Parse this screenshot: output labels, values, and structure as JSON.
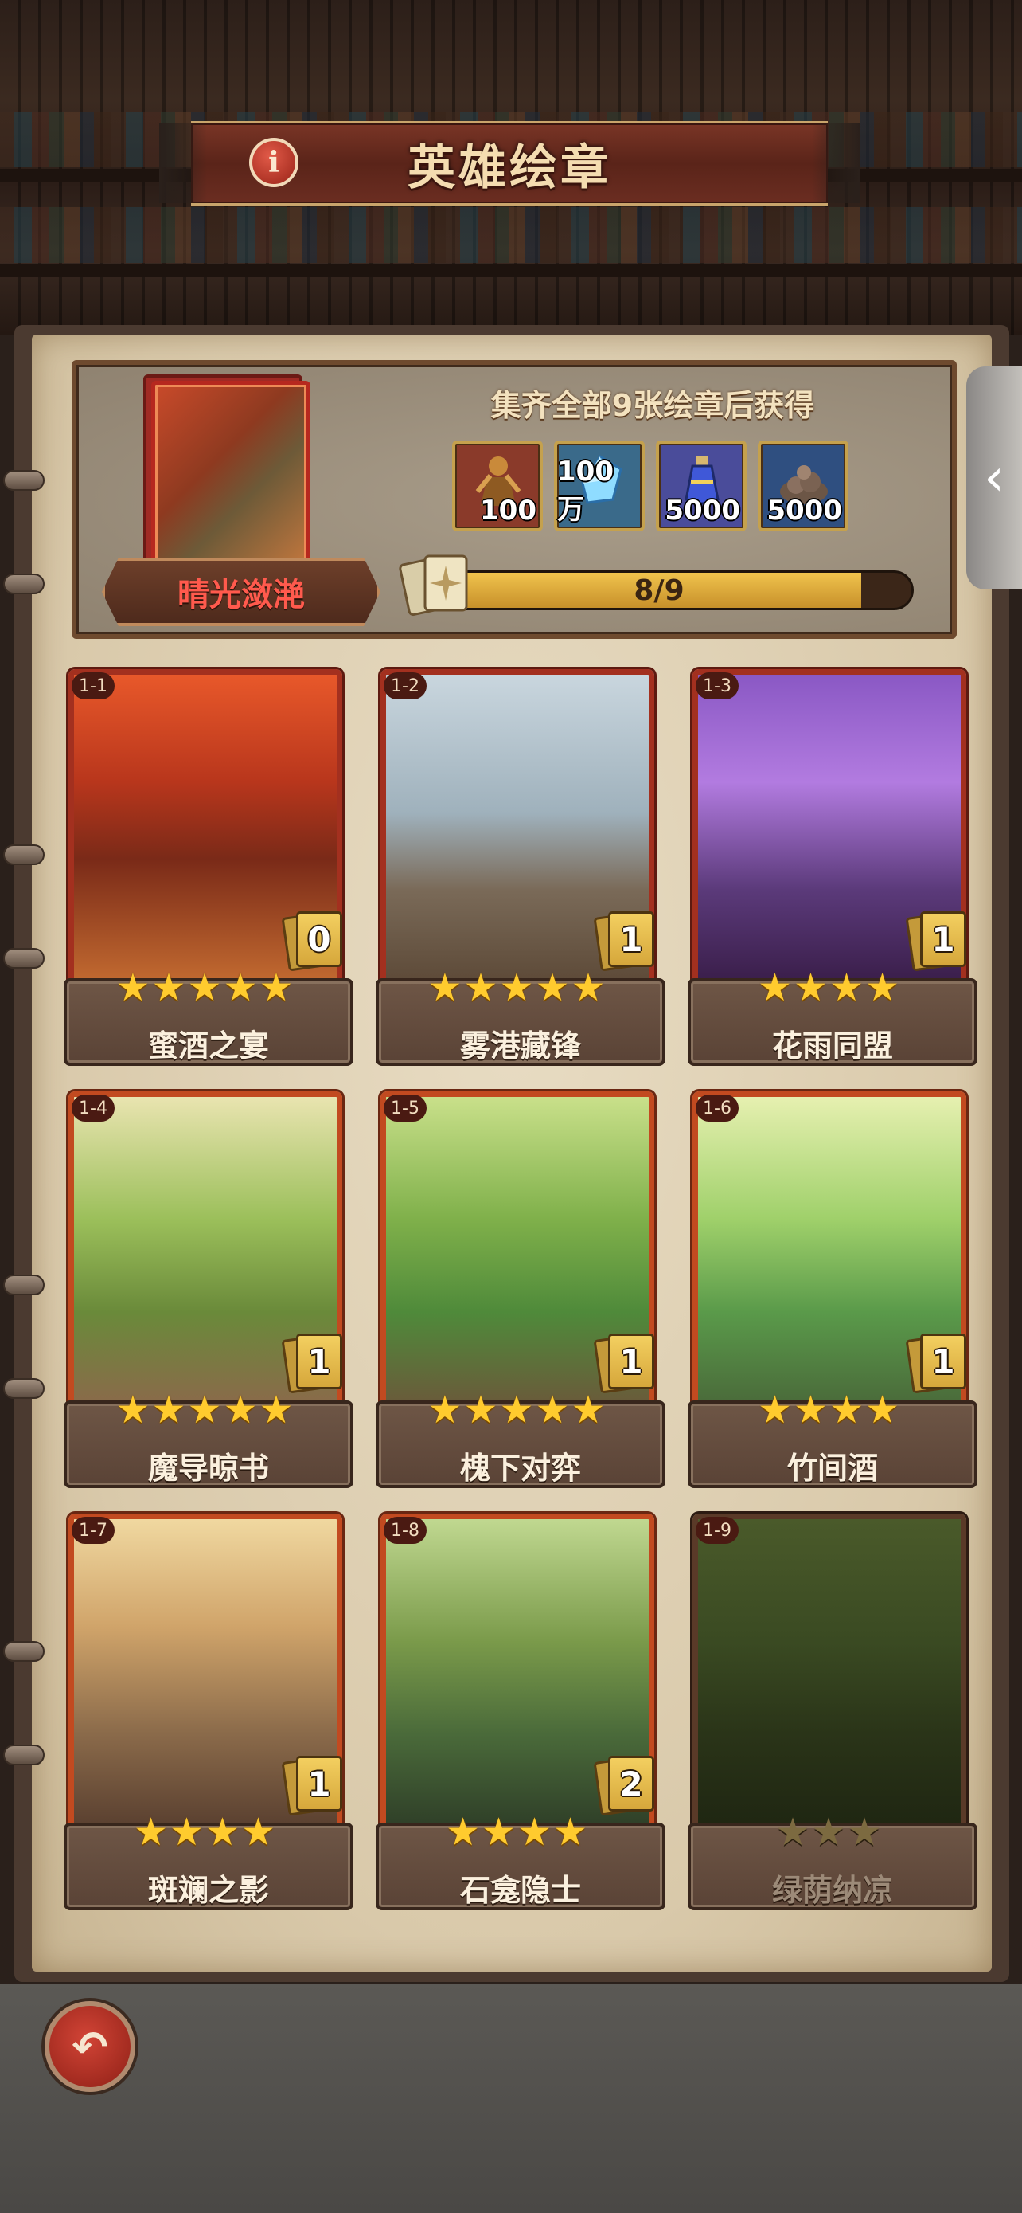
{
  "header": {
    "title": "英雄绘章",
    "info_icon": "info-icon"
  },
  "reward": {
    "cover_name": "晴光潋滟",
    "title": "集齐全部9张绘章后获得",
    "items": [
      {
        "icon": "hero-silhouette-icon",
        "qty": "100",
        "bg": "#8a3a2a"
      },
      {
        "icon": "blue-crystal-icon",
        "qty": "100万",
        "bg": "#3a6a8a"
      },
      {
        "icon": "potion-bottle-icon",
        "qty": "5000",
        "bg": "#4a4c9a"
      },
      {
        "icon": "ore-pile-icon",
        "qty": "5000",
        "bg": "#2f4f80"
      }
    ],
    "progress": {
      "current": 8,
      "total": 9,
      "label": "8/9"
    }
  },
  "cards": [
    {
      "id": "1-1",
      "name": "蜜酒之宴",
      "count": "0",
      "stars": "★★★★★",
      "frame": "red",
      "art": "feast"
    },
    {
      "id": "1-2",
      "name": "雾港藏锋",
      "count": "1",
      "stars": "★★★★★",
      "frame": "red",
      "art": "harbor"
    },
    {
      "id": "1-3",
      "name": "花雨同盟",
      "count": "1",
      "stars": "★★★★",
      "frame": "red",
      "art": "blossom"
    },
    {
      "id": "1-4",
      "name": "魔导晾书",
      "count": "1",
      "stars": "★★★★★",
      "frame": "orange",
      "art": "books"
    },
    {
      "id": "1-5",
      "name": "槐下对弈",
      "count": "1",
      "stars": "★★★★★",
      "frame": "orange",
      "art": "chess"
    },
    {
      "id": "1-6",
      "name": "竹间酒",
      "count": "1",
      "stars": "★★★★",
      "frame": "orange",
      "art": "bamboo"
    },
    {
      "id": "1-7",
      "name": "斑斓之影",
      "count": "1",
      "stars": "★★★★",
      "frame": "orange",
      "art": "glass"
    },
    {
      "id": "1-8",
      "name": "石龛隐士",
      "count": "2",
      "stars": "★★★★",
      "frame": "orange",
      "art": "hermit"
    },
    {
      "id": "1-9",
      "name": "绿荫纳凉",
      "count": "",
      "stars": "★★★",
      "frame": "dim",
      "art": "shade"
    }
  ],
  "side_tab_icon": "chevron-left-icon",
  "back_icon": "back-arrow-icon",
  "colors": {
    "accent": "#f0c34d",
    "banner": "#6b2d21",
    "parchment": "#e8dcc3"
  }
}
